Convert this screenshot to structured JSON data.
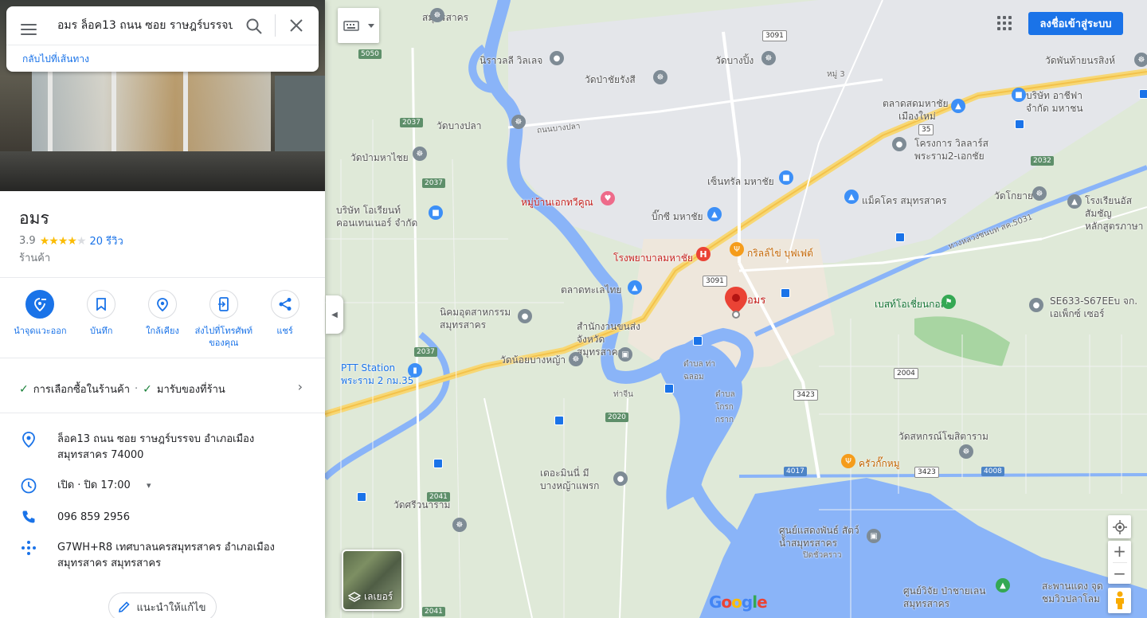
{
  "search": {
    "query": "อมร ล็อค13 ถนน ซอย ราษฎร์บรรจบ",
    "back_link": "กลับไปที่เส้นทาง"
  },
  "place": {
    "name": "อมร",
    "rating": "3.9",
    "stars_filled": 4,
    "reviews": "20 รีวิว",
    "category": "ร้านค้า"
  },
  "actions": [
    {
      "label": "นำจุดแวะออก",
      "icon": "remove-stop-icon"
    },
    {
      "label": "บันทึก",
      "icon": "bookmark-icon"
    },
    {
      "label": "ใกล้เคียง",
      "icon": "nearby-icon"
    },
    {
      "label": "ส่งไปที่โทรศัพท์ของคุณ",
      "icon": "send-to-phone-icon"
    },
    {
      "label": "แชร์",
      "icon": "share-icon"
    }
  ],
  "service_options": {
    "option1": "การเลือกซื้อในร้านค้า",
    "separator": "·",
    "option2": "มารับของที่ร้าน"
  },
  "info": {
    "address": "ล็อค13 ถนน ซอย ราษฎร์บรรจบ อำเภอเมือง สมุทรสาคร 74000",
    "hours": "เปิด · ปิด 17:00",
    "phone": "096 859 2956",
    "plus_code": "G7WH+R8 เทศบาลนครสมุทรสาคร อำเภอเมือง สมุทรสาคร สมุทรสาคร"
  },
  "suggest_edit": "แนะนำให้แก้ไข",
  "map": {
    "signin": "ลงชื่อเข้าสู่ระบบ",
    "layers": "เลเยอร์",
    "logo": "Google",
    "pin_label": "อมร",
    "labels": [
      "สมุทรสาคร",
      "นิราวลลี วิลเลจ",
      "วัดป่าชัยรังสี",
      "วัดบางปิ้ง",
      "หมู่ 3",
      "วัดพันท้ายนรสิงห์",
      "ตลาดสดมหาชัย",
      "เมืองใหม่",
      "บริษัท อาชีฟา จำกัด มหาชน",
      "วัดบางปลา",
      "ถนนบางปลา",
      "โครงการ วิลลาร์ส พระราม2-เอกชัย",
      "วัดป่ามหาไชย",
      "เซ็นทรัล มหาชัย",
      "หมู่บ้านเอกทวีคูณ",
      "แม็คโคร สมุทรสาคร",
      "วัดโกยาย",
      "โรงเรียนอัสสัมชัญ หลักสูตรภาษา",
      "บริษัท โอเรียนท์ คอนเทนเนอร์ จำกัด",
      "บิ๊กซี มหาชัย",
      "โรงพยาบาลมหาชัย",
      "กริลล์ไข่ บุฟเฟต์",
      "ตลาดทะเลไทย",
      "นิคมอุตสาหกรรม สมุทรสาคร",
      "สำนักงานขนส่ง จังหวัดสมุทรสาคร",
      "เบสท์โอเชี่ยนกอล์ฟ",
      "SE633-S67EEบ จก. เอเพ็กซ์ เซอร์",
      "PTT Station พระราม 2 กม.35",
      "วัดน้อยบางหญ้า",
      "ตำบล ท่าฉลอม",
      "ท่าจีน",
      "ตำบล โกรกกราก",
      "วัดสหกรณ์โฆสิตาราม",
      "ครัวกั๊กหมู",
      "เดอะมินนี่ มี บางหญ้าแพรก",
      "วัดศรีวนาราม",
      "ศูนย์แสดงพันธ์ สัตว์น้ำสมุทรสาคร",
      "ปิดชั่วคราว",
      "ศูนย์วิจัย ป่าชายเลน สมุทรสาคร",
      "สะพานแดง จุดชมวิวปลาโลม",
      "ทางหลวงชนบท สค.5031"
    ],
    "shields": [
      "3091",
      "5050",
      "2037",
      "2037",
      "35",
      "2032",
      "3091",
      "2037",
      "2004",
      "3423",
      "2020",
      "4017",
      "3423",
      "4008",
      "2041",
      "2041"
    ]
  }
}
